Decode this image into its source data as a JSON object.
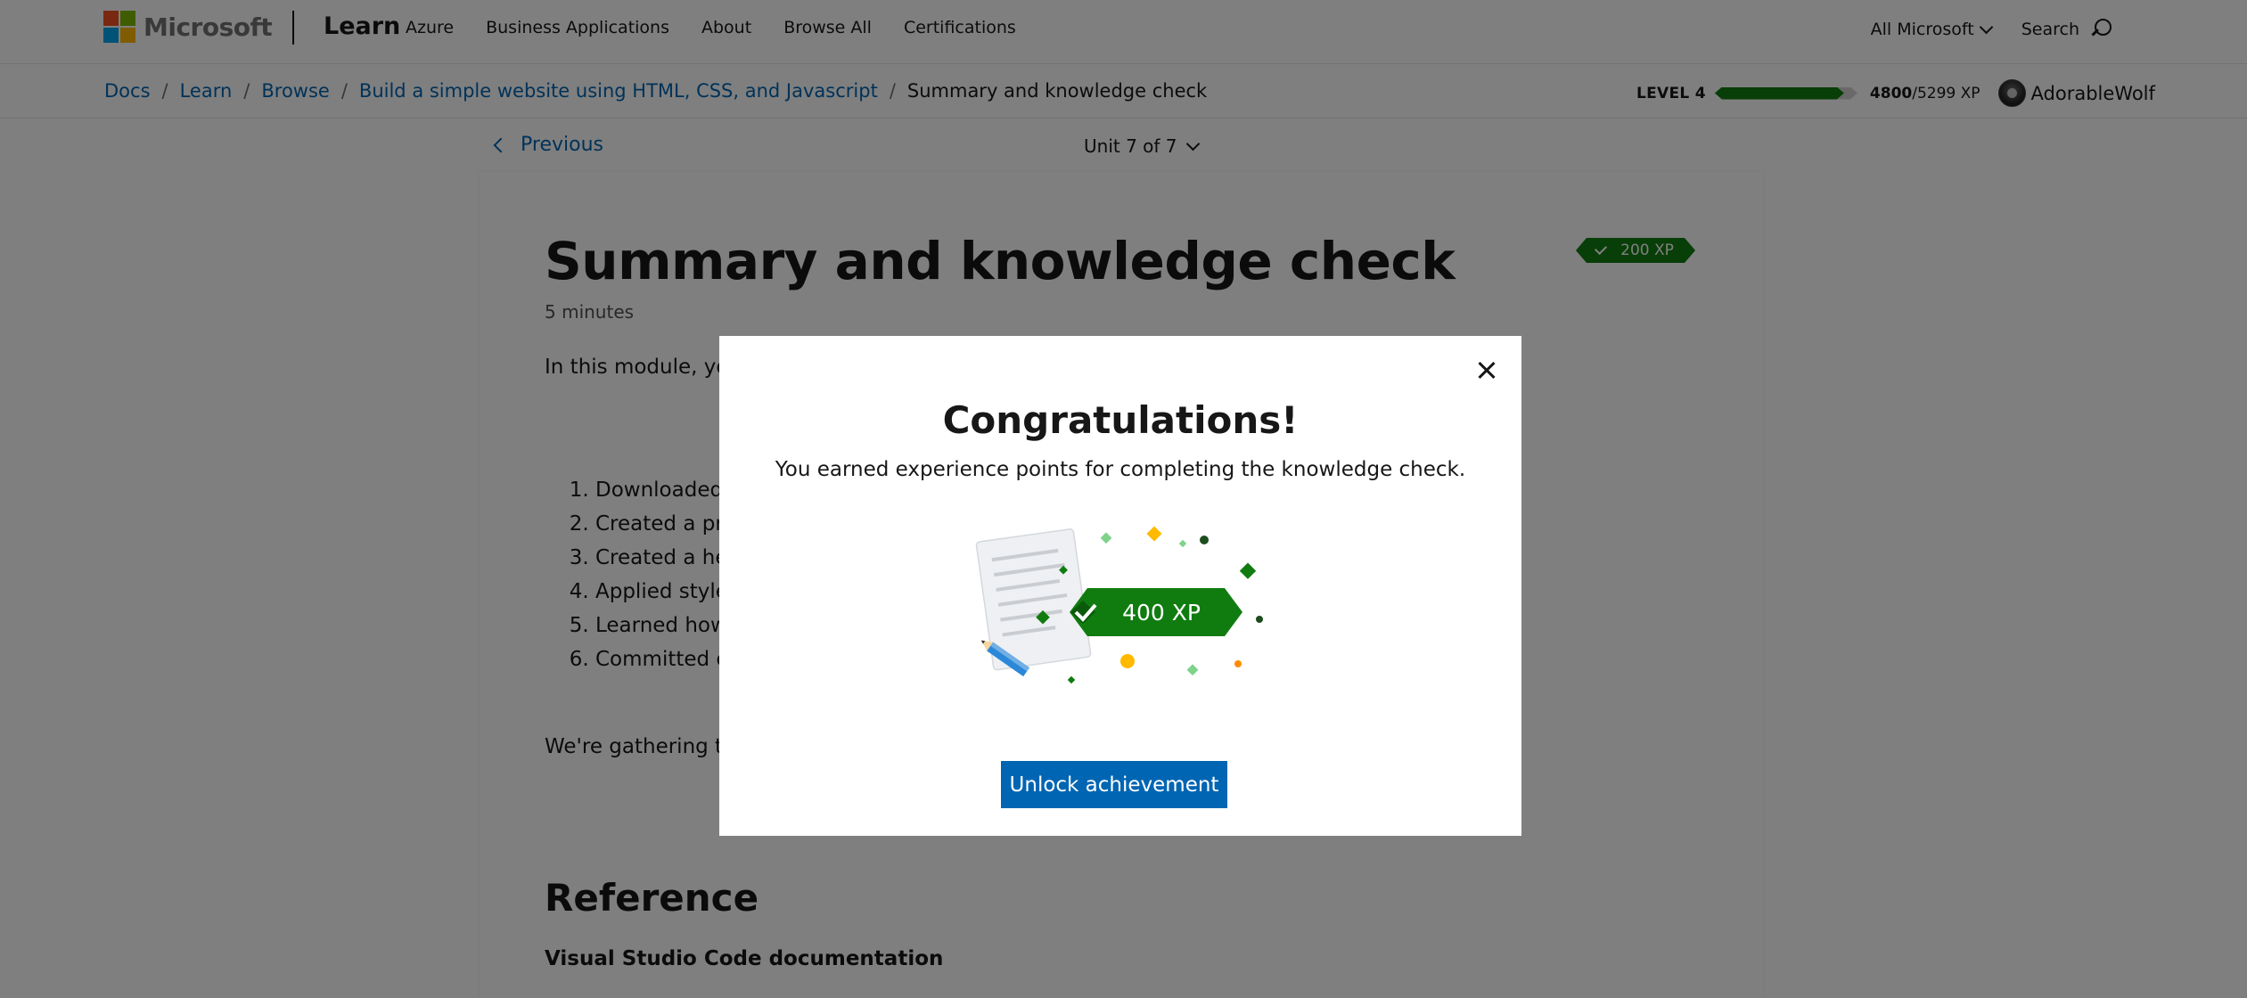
{
  "header": {
    "brand": "Microsoft",
    "product": "Learn",
    "nav_links": [
      "Azure",
      "Business Applications",
      "About",
      "Browse All",
      "Certifications"
    ],
    "all_microsoft": "All Microsoft",
    "search_label": "Search"
  },
  "breadcrumb": {
    "items": [
      "Docs",
      "Learn",
      "Browse",
      "Build a simple website using HTML, CSS, and Javascript"
    ],
    "current": "Summary and knowledge check",
    "separator": "/"
  },
  "progress": {
    "level_label": "LEVEL 4",
    "xp_current": "4800",
    "xp_total": "/5299 XP",
    "fraction": 0.906
  },
  "user": {
    "name": "AdorableWolf"
  },
  "unit_nav": {
    "previous": "Previous",
    "unit": "Unit 7 of 7"
  },
  "article": {
    "title": "Summary and knowledge check",
    "xp_badge": "200 XP",
    "duration": "5 minutes",
    "intro": "In this module, you created a website and tested that everything you accomplished! You have:",
    "steps": [
      "Downloaded basic packages and configured",
      "Created a pro",
      "Created a hea page in a browser.",
      "Applied styles",
      "Learned how",
      "Committed c"
    ],
    "closing": "We're gathering to next time. Remember you can row, you'll be more able to fulfill",
    "reference_heading": "Reference",
    "reference_item": "Visual Studio Code documentation"
  },
  "modal": {
    "title": "Congratulations!",
    "message": "You earned experience points for completing the knowledge check.",
    "xp_award": "400 XP",
    "button": "Unlock achievement"
  },
  "colors": {
    "accent_blue": "#0065b3",
    "xp_green": "#107c10",
    "overlay": "rgba(0,0,0,0.5)"
  },
  "icons": [
    "microsoft-logo",
    "chevron-down-icon",
    "search-icon",
    "chevron-left-icon",
    "check-icon",
    "close-icon",
    "pencil-icon",
    "document-icon"
  ]
}
